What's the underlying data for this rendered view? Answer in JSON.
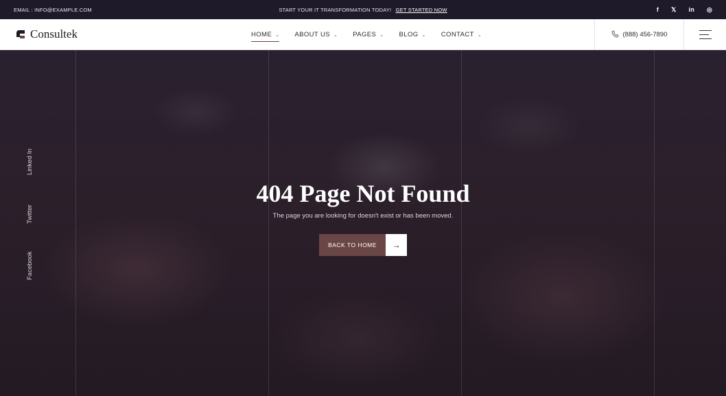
{
  "topbar": {
    "email": "EMAIL : INFO@EXAMPLE.COM",
    "promo_text": "START YOUR IT TRANSFORMATION TODAY!",
    "promo_link": "GET STARTED NOW",
    "social": [
      "f",
      "𝕏",
      "in",
      "◎"
    ]
  },
  "header": {
    "logo_text": "Consultek",
    "nav": [
      {
        "label": "HOME"
      },
      {
        "label": "ABOUT US"
      },
      {
        "label": "PAGES"
      },
      {
        "label": "BLOG"
      },
      {
        "label": "CONTACT"
      }
    ],
    "phone": "(888) 456-7890"
  },
  "side_social": [
    "Linked In",
    "Twitter",
    "Facebook"
  ],
  "hero": {
    "title": "404 Page Not Found",
    "subtitle": "The page you are looking for doesn't exist or has been moved.",
    "button_label": "BACK TO HOME",
    "button_arrow": "→"
  },
  "colors": {
    "accent": "#6b4646",
    "topbar_bg": "#1f1a2a"
  }
}
